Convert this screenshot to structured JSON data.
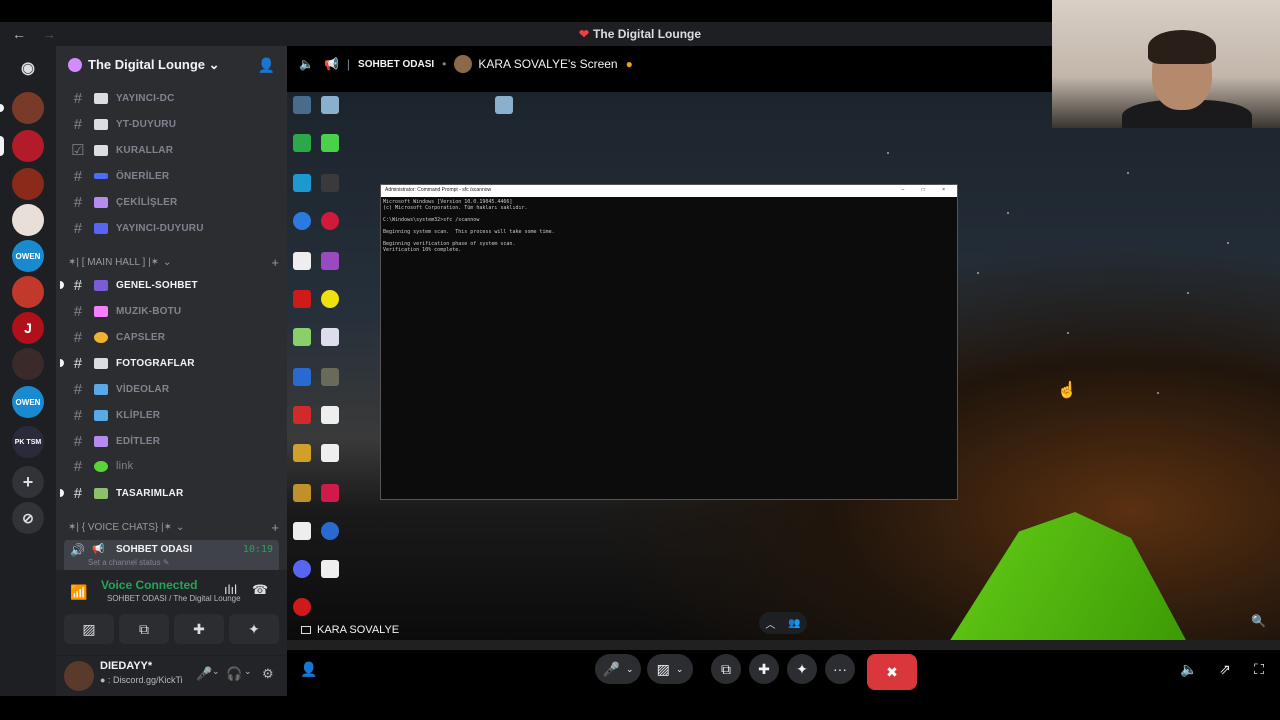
{
  "window": {
    "title": "The Digital Lounge"
  },
  "server": {
    "name": "The Digital Lounge",
    "name_with_chevron": "The Digital Lounge ⌄"
  },
  "channels": [
    {
      "name": "YAYINCI-DC",
      "emoji_color": "#dbdee1"
    },
    {
      "name": "YT-DUYURU",
      "emoji_color": "#dbdee1"
    },
    {
      "name": "KURALLAR",
      "emoji_color": "#dbdee1"
    },
    {
      "name": "ÖNERİLER",
      "emoji_color": "#4a6cf7"
    },
    {
      "name": "ÇEKİLİŞLER",
      "emoji_color": "#b48cf0"
    },
    {
      "name": "YAYINCI-DUYURU",
      "emoji_color": "#5865f2"
    }
  ],
  "categories": {
    "main_hall": "✶| [ MAIN HALL ] |✶",
    "voice_chats": "✶| { VOICE CHATS} |✶"
  },
  "main_hall_channels": [
    {
      "name": "GENEL-SOHBET",
      "unread": true,
      "emoji_color": "#7b5cd6"
    },
    {
      "name": "MUZIK-BOTU",
      "unread": false,
      "emoji_color": "#f47fff"
    },
    {
      "name": "CAPSLER",
      "unread": false,
      "emoji_color": "#f0b232"
    },
    {
      "name": "FOTOGRAFLAR",
      "unread": true,
      "emoji_color": "#dbdee1"
    },
    {
      "name": "VİDEOLAR",
      "unread": false,
      "emoji_color": "#5aa9e6"
    },
    {
      "name": "KLİPLER",
      "unread": false,
      "emoji_color": "#5aa9e6"
    },
    {
      "name": "EDİTLER",
      "unread": false,
      "emoji_color": "#b48cf0"
    },
    {
      "name": "link",
      "unread": false,
      "emoji_color": "#5bd33a"
    },
    {
      "name": "TASARIMLAR",
      "unread": true,
      "emoji_color": "#8ec06c"
    }
  ],
  "active_voice": {
    "name": "SOHBET ODASI",
    "time": "10:19",
    "status_placeholder": "Set a channel status ✎"
  },
  "voice_panel": {
    "title": "Voice Connected",
    "subtitle": "SOHBET ODASI / The Digital Lounge"
  },
  "user": {
    "name": "DIEDAYY*",
    "status": "● : Discord.gg/KickTi"
  },
  "stream": {
    "channel": "SOHBET ODASI",
    "screen_title": "KARA SOVALYE's Screen",
    "streamer": "KARA SOVALYE"
  },
  "cmd": {
    "title": "Administrator: Command Prompt - sfc /scannow",
    "lines": "Microsoft Windows [Version 10.0.19045.4466]\n(c) Microsoft Corporation. Tüm hakları saklıdır.\n\nC:\\Windows\\system32>sfc /scannow\n\nBeginning system scan.  This process will take some time.\n\nBeginning verification phase of system scan.\nVerification 10% complete."
  },
  "icons": {
    "back": "←",
    "forward": "→",
    "hash": "#",
    "speaker": "🔊",
    "mic": "🎤",
    "headphones": "🎧",
    "gear": "⚙",
    "plus": "+",
    "add_user": "👤+",
    "end_call": "✖",
    "more": "···"
  },
  "colors": {
    "accent_green": "#23a55a",
    "end_call_red": "#da373c",
    "sidebar_bg": "#2b2d31",
    "rail_bg": "#1e1f22"
  }
}
